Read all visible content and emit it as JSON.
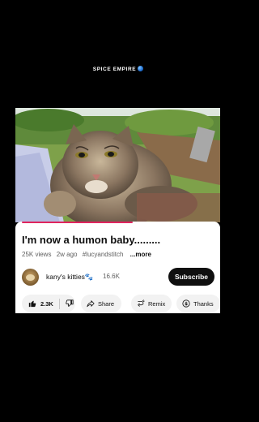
{
  "watermark": {
    "text": "SPICE EMPIRE"
  },
  "video": {
    "progress_fraction": 0.58
  },
  "title": "I'm now a humon baby.........",
  "meta": {
    "views": "25K views",
    "age": "2w ago",
    "hashtag": "#lucyandstitch",
    "more": "...more"
  },
  "channel": {
    "name": "kany's kitties🐾",
    "subscribers": "16.6K",
    "subscribe_label": "Subscribe"
  },
  "actions": {
    "like_count": "2.3K",
    "share_label": "Share",
    "remix_label": "Remix",
    "thanks_label": "Thanks"
  },
  "icons": [
    "globe-icon",
    "thumbs-up-icon",
    "thumbs-down-icon",
    "share-icon",
    "remix-icon",
    "thanks-icon"
  ],
  "colors": {
    "progress": "#e0245e",
    "subscribe_bg": "#0f0f0f"
  }
}
